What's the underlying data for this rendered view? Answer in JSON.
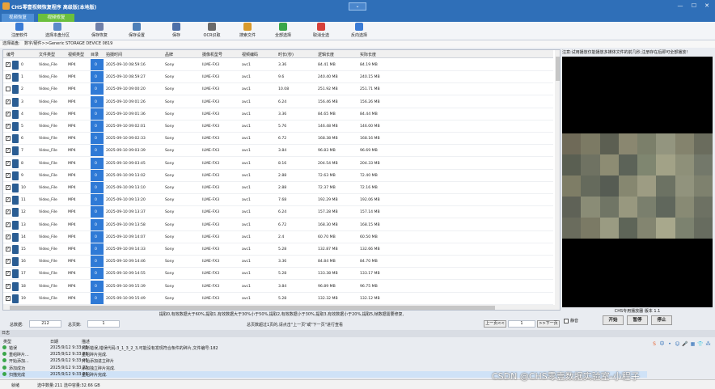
{
  "window": {
    "title": "CHS零壹视频恢复程序 高级版(本地版)",
    "collapse_glyph": "⌄",
    "min_glyph": "—",
    "max_glyph": "☐",
    "close_glyph": "✕"
  },
  "tabs": [
    "视频恢复",
    "视频修复"
  ],
  "toolbar": [
    {
      "label": "注册软件",
      "icon": "register-icon",
      "color": "#3a7bd5"
    },
    {
      "label": "选择本盘分区",
      "icon": "disk-icon",
      "color": "#5b8ac9"
    },
    {
      "label": "保存恢复",
      "icon": "save-recover-icon",
      "color": "#6f7fa8"
    },
    {
      "label": "保存设置",
      "icon": "settings-icon",
      "color": "#4d7fb8"
    },
    {
      "label": "保存",
      "icon": "save-icon",
      "color": "#4d6fa8"
    },
    {
      "label": "OCR识取",
      "icon": "ocr-icon",
      "color": "#6a6a6a"
    },
    {
      "label": "搜索文件",
      "icon": "search-file-icon",
      "color": "#d99a2b"
    },
    {
      "label": "全部选择",
      "icon": "check-all-icon",
      "color": "#3aa64a"
    },
    {
      "label": "取消全选",
      "icon": "uncheck-all-icon",
      "color": "#d6403a"
    },
    {
      "label": "反向选择",
      "icon": "invert-select-icon",
      "color": "#3a7bd5"
    }
  ],
  "path": {
    "label": "选择磁盘:",
    "value": "数字/硬件>>Generic STORAGE DEVICE 0819"
  },
  "table": {
    "headers": [
      "编号",
      "文件类型",
      "视频类型",
      "目录",
      "拍摄时间",
      "品牌",
      "摄像机型号",
      "视频编码",
      "时长(秒)",
      "逻辑长度",
      "实际长度"
    ],
    "rows": [
      {
        "checked": true,
        "no": "0",
        "type": "Video_File",
        "vtype": "MP4",
        "dir": "0",
        "time": "2025-09-10 08:59:16",
        "brand": "Sony",
        "model": "ILME-FX3",
        "codec": "avc1",
        "dur": "3.36",
        "logic": "84.41 MB",
        "actual": "84.19 MB"
      },
      {
        "checked": true,
        "no": "1",
        "type": "Video_File",
        "vtype": "MP4",
        "dir": "0",
        "time": "2025-09-10 08:59:27",
        "brand": "Sony",
        "model": "ILME-FX3",
        "codec": "avc1",
        "dur": "9.6",
        "logic": "240.40 MB",
        "actual": "240.15 MB"
      },
      {
        "checked": false,
        "no": "2",
        "type": "Video_File",
        "vtype": "MP4",
        "dir": "0",
        "time": "2025-09-10 09:00:20",
        "brand": "Sony",
        "model": "ILME-FX3",
        "codec": "avc1",
        "dur": "10.08",
        "logic": "251.92 MB",
        "actual": "251.71 MB"
      },
      {
        "checked": true,
        "no": "3",
        "type": "Video_File",
        "vtype": "MP4",
        "dir": "0",
        "time": "2025-09-10 09:01:26",
        "brand": "Sony",
        "model": "ILME-FX3",
        "codec": "avc1",
        "dur": "6.24",
        "logic": "156.46 MB",
        "actual": "156.26 MB"
      },
      {
        "checked": true,
        "no": "4",
        "type": "Video_File",
        "vtype": "MP4",
        "dir": "0",
        "time": "2025-09-10 09:01:36",
        "brand": "Sony",
        "model": "ILME-FX3",
        "codec": "avc1",
        "dur": "3.36",
        "logic": "84.65 MB",
        "actual": "84.44 MB"
      },
      {
        "checked": true,
        "no": "5",
        "type": "Video_File",
        "vtype": "MP4",
        "dir": "0",
        "time": "2025-09-10 09:02:01",
        "brand": "Sony",
        "model": "ILME-FX3",
        "codec": "avc1",
        "dur": "5.76",
        "logic": "146.48 MB",
        "actual": "146.00 MB"
      },
      {
        "checked": true,
        "no": "6",
        "type": "Video_File",
        "vtype": "MP4",
        "dir": "0",
        "time": "2025-09-10 09:02:33",
        "brand": "Sony",
        "model": "ILME-FX3",
        "codec": "avc1",
        "dur": "6.72",
        "logic": "168.38 MB",
        "actual": "168.16 MB"
      },
      {
        "checked": true,
        "no": "7",
        "type": "Video_File",
        "vtype": "MP4",
        "dir": "0",
        "time": "2025-09-10 09:03:39",
        "brand": "Sony",
        "model": "ILME-FX3",
        "codec": "avc1",
        "dur": "3.84",
        "logic": "96.83 MB",
        "actual": "96.69 MB"
      },
      {
        "checked": true,
        "no": "8",
        "type": "Video_File",
        "vtype": "MP4",
        "dir": "0",
        "time": "2025-09-10 09:03:45",
        "brand": "Sony",
        "model": "ILME-FX3",
        "codec": "avc1",
        "dur": "8.16",
        "logic": "204.54 MB",
        "actual": "204.33 MB"
      },
      {
        "checked": true,
        "no": "9",
        "type": "Video_File",
        "vtype": "MP4",
        "dir": "0",
        "time": "2025-09-10 09:13:02",
        "brand": "Sony",
        "model": "ILME-FX3",
        "codec": "avc1",
        "dur": "2.88",
        "logic": "72.63 MB",
        "actual": "72.40 MB"
      },
      {
        "checked": true,
        "no": "10",
        "type": "Video_File",
        "vtype": "MP4",
        "dir": "0",
        "time": "2025-09-10 09:13:10",
        "brand": "Sony",
        "model": "ILME-FX3",
        "codec": "avc1",
        "dur": "2.88",
        "logic": "72.37 MB",
        "actual": "72.16 MB"
      },
      {
        "checked": true,
        "no": "11",
        "type": "Video_File",
        "vtype": "MP4",
        "dir": "0",
        "time": "2025-09-10 09:13:20",
        "brand": "Sony",
        "model": "ILME-FX3",
        "codec": "avc1",
        "dur": "7.68",
        "logic": "192.29 MB",
        "actual": "192.06 MB"
      },
      {
        "checked": true,
        "no": "12",
        "type": "Video_File",
        "vtype": "MP4",
        "dir": "0",
        "time": "2025-09-10 09:13:37",
        "brand": "Sony",
        "model": "ILME-FX3",
        "codec": "avc1",
        "dur": "6.24",
        "logic": "157.28 MB",
        "actual": "157.14 MB"
      },
      {
        "checked": true,
        "no": "13",
        "type": "Video_File",
        "vtype": "MP4",
        "dir": "0",
        "time": "2025-09-10 09:13:58",
        "brand": "Sony",
        "model": "ILME-FX3",
        "codec": "avc1",
        "dur": "6.72",
        "logic": "168.30 MB",
        "actual": "168.15 MB"
      },
      {
        "checked": true,
        "no": "14",
        "type": "Video_File",
        "vtype": "MP4",
        "dir": "0",
        "time": "2025-09-10 09:14:07",
        "brand": "Sony",
        "model": "ILME-FX3",
        "codec": "avc1",
        "dur": "2.4",
        "logic": "60.70 MB",
        "actual": "60.50 MB"
      },
      {
        "checked": true,
        "no": "15",
        "type": "Video_File",
        "vtype": "MP4",
        "dir": "0",
        "time": "2025-09-10 09:14:33",
        "brand": "Sony",
        "model": "ILME-FX3",
        "codec": "avc1",
        "dur": "5.28",
        "logic": "132.87 MB",
        "actual": "132.66 MB"
      },
      {
        "checked": true,
        "no": "16",
        "type": "Video_File",
        "vtype": "MP4",
        "dir": "0",
        "time": "2025-09-10 09:14:46",
        "brand": "Sony",
        "model": "ILME-FX3",
        "codec": "avc1",
        "dur": "3.36",
        "logic": "84.84 MB",
        "actual": "84.70 MB"
      },
      {
        "checked": true,
        "no": "17",
        "type": "Video_File",
        "vtype": "MP4",
        "dir": "0",
        "time": "2025-09-10 09:14:55",
        "brand": "Sony",
        "model": "ILME-FX3",
        "codec": "avc1",
        "dur": "5.28",
        "logic": "133.38 MB",
        "actual": "133.17 MB"
      },
      {
        "checked": true,
        "no": "18",
        "type": "Video_File",
        "vtype": "MP4",
        "dir": "0",
        "time": "2025-09-10 09:15:39",
        "brand": "Sony",
        "model": "ILME-FX3",
        "codec": "avc1",
        "dur": "3.84",
        "logic": "96.89 MB",
        "actual": "96.75 MB"
      },
      {
        "checked": true,
        "no": "19",
        "type": "Video_File",
        "vtype": "MP4",
        "dir": "0",
        "time": "2025-09-10 09:15:49",
        "brand": "Sony",
        "model": "ILME-FX3",
        "codec": "avc1",
        "dur": "5.28",
        "logic": "132.32 MB",
        "actual": "132.12 MB"
      }
    ]
  },
  "hint": "提取0,有效数据大于60%,提取1,有效数据大于30%小于50%,提取2,有效数据小于30%,提取3,有效数据小于20%,提取5,帧数据需要修复,",
  "stats": {
    "total_label": "总数据:",
    "total": "212",
    "pages_label": "总页数:",
    "pages": "1",
    "page_info": "总页数超过1页的,请点击\"上一页\"或\"下一页\"进行查看",
    "prev": "上一页<<",
    "page": "1",
    "next": ">>下一页"
  },
  "preview": {
    "note": "注意:试用播放仅能播放多媒体文件的前几秒,注册存在后即可全部播放!",
    "caption": "CHS专用播放器 版本 1.1",
    "mute": "静音",
    "buttons": [
      "开始",
      "暂停",
      "停止"
    ],
    "colors": [
      "#6f6a58",
      "#7c7a64",
      "#5c5f52",
      "#8a8770",
      "#7b7f6a",
      "#93957f",
      "#84836d",
      "#6a6c5d",
      "#5a5f52",
      "#6f7262",
      "#8d8c73",
      "#5c6358",
      "#7f8670",
      "#a2a287",
      "#8e9079",
      "#73786a",
      "#7e7d66",
      "#656a5c",
      "#565c53",
      "#868770",
      "#9d9c83",
      "#6c7263",
      "#91937d",
      "#7e816e",
      "#5f6257",
      "#8a8c76",
      "#707565",
      "#98987f",
      "#7a7f6d",
      "#60675c",
      "#888a74",
      "#6d7163",
      "#6a6c5d",
      "#7b7a65",
      "#9a9b82",
      "#5e6558",
      "#838570",
      "#a8a88c",
      "#7c826f",
      "#676c5f"
    ]
  },
  "log": {
    "title": "日志",
    "headers": [
      "类型",
      "日期",
      "描述"
    ],
    "rows": [
      {
        "type": "错误",
        "date": "2025/9/12 9:33:25",
        "desc": "判断错误,错误代码:3_1_3_2_3,可能没有发现符合条件的碎片,文件编号:182"
      },
      {
        "type": "重组碎片...",
        "date": "2025/9/12 9:33:25",
        "desc": "重组碎片完成."
      },
      {
        "type": "开始添加...",
        "date": "2025/9/12 9:33:25",
        "desc": "开始添加进立碎片"
      },
      {
        "type": "添加成功",
        "date": "2025/9/12 9:33:25",
        "desc": "添加独立碎片完成."
      },
      {
        "type": "扫描完成",
        "date": "2025/9/12 9:33:25",
        "desc": "重组碎片完成."
      }
    ]
  },
  "status": {
    "ready": "就绪",
    "selected": "选中数量:211 选中容量:32.66 GB"
  },
  "tray": [
    "S",
    "中",
    "•",
    "☺",
    "🎤",
    "▦",
    "👕",
    "⁂"
  ],
  "watermark": "CSDN @CHS零壹数据实验室-小程子"
}
